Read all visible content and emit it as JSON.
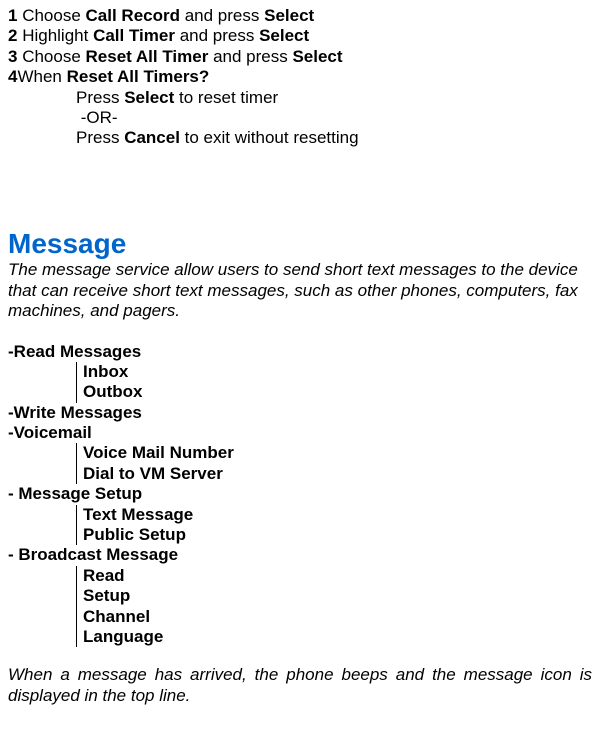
{
  "steps": {
    "s1_num": "1",
    "s1_pre": " Choose ",
    "s1_b1": "Call Record",
    "s1_mid": " and press ",
    "s1_b2": "Select",
    "s2_num": "2",
    "s2_pre": " Highlight ",
    "s2_b1": "Call Timer",
    "s2_mid": " and press ",
    "s2_b2": "Select",
    "s3_num": "3",
    "s3_pre": " Choose ",
    "s3_b1": "Reset All Timer",
    "s3_mid": " and press ",
    "s3_b2": "Select",
    "s4_num": "4",
    "s4_pre": "When ",
    "s4_b1": "Reset All Timers?"
  },
  "indented": {
    "l1_pre": "Press ",
    "l1_b": "Select",
    "l1_post": " to reset timer",
    "l2": " -OR-",
    "l3_pre": "Press ",
    "l3_b": "Cancel",
    "l3_post": " to exit without resetting"
  },
  "section_title": "Message",
  "section_intro": "The message service allow users to send short text messages to the device that can receive short text messages, such as other phones, computers, fax machines, and pagers.",
  "tree": {
    "read_messages": "-Read Messages",
    "inbox": "Inbox",
    "outbox": "Outbox",
    "write_messages": "-Write Messages",
    "voicemail": "-Voicemail",
    "vm_number": "Voice Mail Number",
    "dial_vm": "Dial to VM Server",
    "msg_setup": "- Message Setup",
    "text_message": "Text Message",
    "public_setup": "Public Setup",
    "broadcast": "- Broadcast Message",
    "read": "Read",
    "setup": "Setup",
    "channel": "Channel",
    "language": "Language"
  },
  "footer": "When a message has arrived, the phone beeps and the message icon is displayed in the top line."
}
